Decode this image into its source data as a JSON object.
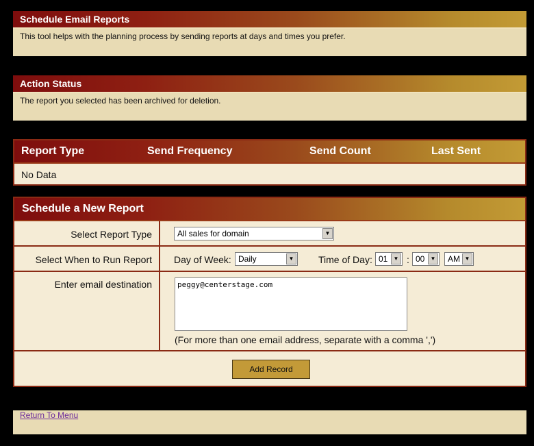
{
  "schedule_panel": {
    "title": "Schedule Email Reports",
    "description": "This tool helps with the planning process by sending reports at days and times you prefer."
  },
  "status_panel": {
    "title": "Action Status",
    "message": "The report you selected has been archived for deletion."
  },
  "report_table": {
    "columns": [
      "Report Type",
      "Send Frequency",
      "Send Count",
      "Last Sent"
    ],
    "empty_text": "No Data"
  },
  "new_report": {
    "title": "Schedule a New Report",
    "report_type_label": "Select Report Type",
    "report_type_value": "All sales for domain",
    "when_label": "Select When to Run Report",
    "day_of_week_label": "Day of Week:",
    "day_of_week_value": "Daily",
    "time_of_day_label": "Time of Day:",
    "hour_value": "01",
    "time_separator": ":",
    "minute_value": "00",
    "ampm_value": "AM",
    "email_label": "Enter email destination",
    "email_value": "peggy@centerstage.com",
    "email_hint": "(For more than one email address, separate with a comma ',')",
    "submit_label": "Add Record"
  },
  "footer": {
    "return_link": "Return To Menu"
  },
  "colors": {
    "header_gradient_start": "#7e0d0d",
    "header_gradient_end": "#c39b35",
    "panel_bg": "#e8dbb4",
    "button_bg": "#c39a38",
    "link": "#6b2a9c"
  }
}
